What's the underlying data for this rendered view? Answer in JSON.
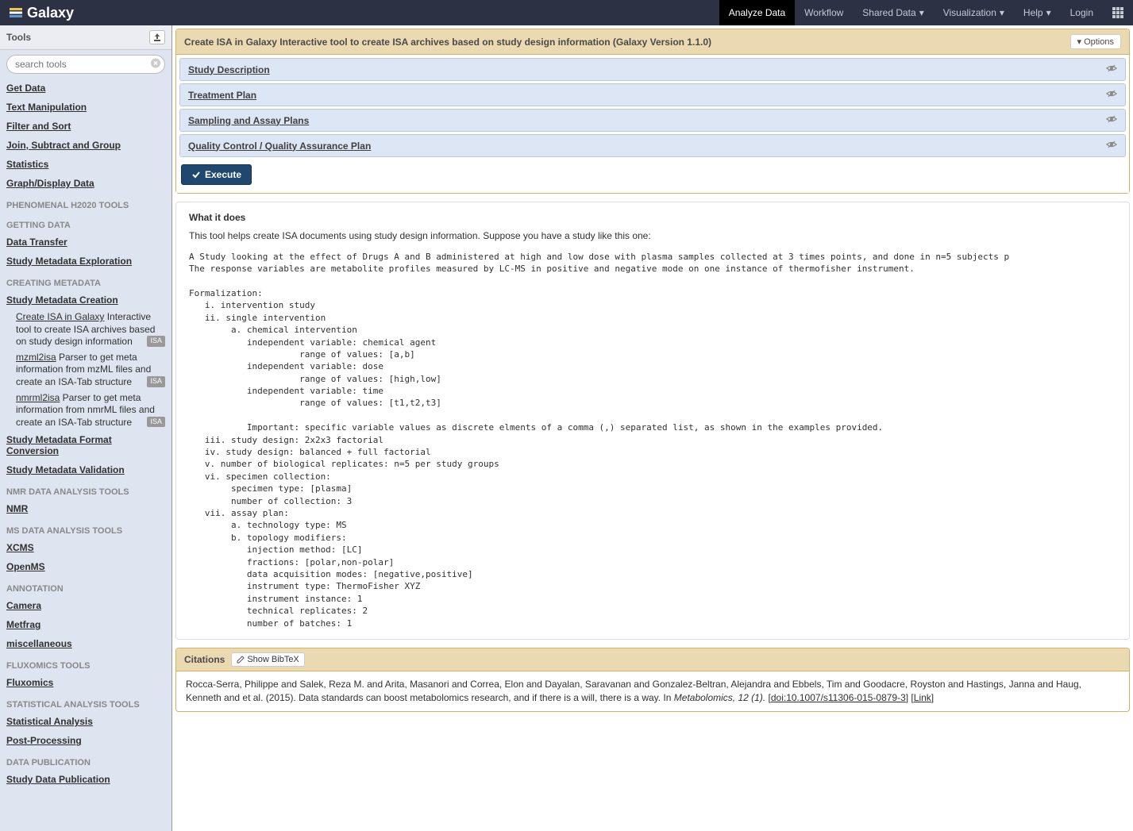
{
  "brand": "Galaxy",
  "nav": {
    "analyze": "Analyze Data",
    "workflow": "Workflow",
    "shared": "Shared Data",
    "viz": "Visualization",
    "help": "Help",
    "login": "Login"
  },
  "sidebar": {
    "title": "Tools",
    "search_placeholder": "search tools",
    "top_links": [
      "Get Data",
      "Text Manipulation",
      "Filter and Sort",
      "Join, Subtract and Group",
      "Statistics",
      "Graph/Display Data"
    ],
    "sections": [
      {
        "header": "PHENOMENAL H2020 TOOLS",
        "links": []
      },
      {
        "header": "GETTING DATA",
        "links": [
          "Data Transfer",
          "Study Metadata Exploration"
        ]
      },
      {
        "header": "CREATING METADATA",
        "links": [
          "Study Metadata Creation"
        ],
        "subtools": [
          {
            "name": "Create ISA in Galaxy",
            "desc": " Interactive tool to create ISA archives based on study design information",
            "badge": "ISA"
          },
          {
            "name": "mzml2isa",
            "desc": " Parser to get meta information from mzML files and create an ISA-Tab structure",
            "badge": "ISA"
          },
          {
            "name": "nmrml2isa",
            "desc": " Parser to get meta information from nmrML files and create an ISA-Tab structure",
            "badge": "ISA"
          }
        ],
        "trailing_links": [
          "Study Metadata Format Conversion",
          "Study Metadata Validation"
        ]
      },
      {
        "header": "NMR DATA ANALYSIS TOOLS",
        "links": [
          "NMR"
        ]
      },
      {
        "header": "MS DATA ANALYSIS TOOLS",
        "links": [
          "XCMS",
          "OpenMS"
        ]
      },
      {
        "header": "ANNOTATION",
        "links": [
          "Camera",
          "Metfrag",
          "miscellaneous"
        ]
      },
      {
        "header": "FLUXOMICS TOOLS",
        "links": [
          "Fluxomics"
        ]
      },
      {
        "header": "STATISTICAL ANALYSIS TOOLS",
        "links": [
          "Statistical Analysis",
          "Post-Processing"
        ]
      },
      {
        "header": "DATA PUBLICATION",
        "links": [
          "Study Data Publication"
        ]
      }
    ]
  },
  "tool": {
    "title": "Create ISA in Galaxy Interactive tool to create ISA archives based on study design information (Galaxy Version 1.1.0)",
    "options_label": "Options",
    "sections": [
      "Study Description",
      "Treatment Plan",
      "Sampling and Assay Plans",
      "Quality Control / Quality Assurance Plan"
    ],
    "execute": "Execute"
  },
  "help": {
    "heading": "What it does",
    "intro": "This tool helps create ISA documents using study design information. Suppose you have a study like this one:",
    "pre": "A Study looking at the effect of Drugs A and B administered at high and low dose with plasma samples collected at 3 times points, and done in n=5 subjects p\nThe response variables are metabolite profiles measured by LC-MS in positive and negative mode on one instance of thermofisher instrument.\n\nFormalization:\n   i. intervention study\n   ii. single intervention\n        a. chemical intervention\n           independent variable: chemical agent\n                     range of values: [a,b]\n           independent variable: dose\n                     range of values: [high,low]\n           independent variable: time\n                     range of values: [t1,t2,t3]\n\n           Important: specific variable values as discrete elments of a comma (,) separated list, as shown in the examples provided.\n   iii. study design: 2x2x3 factorial\n   iv. study design: balanced + full factorial\n   v. number of biological replicates: n=5 per study groups\n   vi. specimen collection:\n        specimen type: [plasma]\n        number of collection: 3\n   vii. assay plan:\n        a. technology type: MS\n        b. topology modifiers:\n           injection method: [LC]\n           fractions: [polar,non-polar]\n           data acquisition modes: [negative,positive]\n           instrument type: ThermoFisher XYZ\n           instrument instance: 1\n           technical replicates: 2\n           number of batches: 1"
  },
  "citations": {
    "title": "Citations",
    "bibtex": "Show BibTeX",
    "text_pre": "Rocca-Serra, Philippe and Salek, Reza M. and Arita, Masanori and Correa, Elon and Dayalan, Saravanan and Gonzalez-Beltran, Alejandra and Ebbels, Tim and Goodacre, Royston and Hastings, Janna and Haug, Kenneth and et al. (2015). Data standards can boost metabolomics research, and if there is a will, there is a way. In ",
    "text_em": "Metabolomics, 12 (1).",
    "doi": "doi:10.1007/s11306-015-0879-3",
    "link": "Link"
  }
}
